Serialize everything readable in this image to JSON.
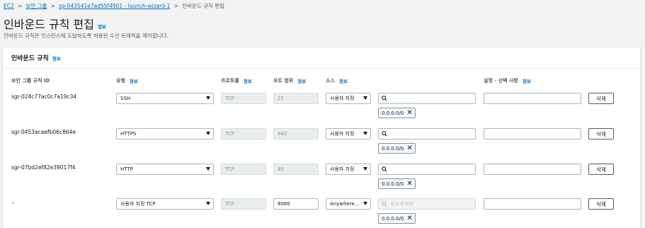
{
  "breadcrumbs": {
    "ec2": "EC2",
    "groups": "보안 그룹",
    "sg": "sg-043541e7ad55f4901 - launch-wizard-1",
    "current": "인바운드 규칙 편집",
    "separator": ">"
  },
  "page": {
    "title": "인바운드 규칙 편집",
    "info": "정보",
    "description": "인바운드 규칙은 인스턴스에 도달하도록 허용된 수신 트래픽을 제어합니다."
  },
  "panel": {
    "title": "인바운드 규칙",
    "info": "정보"
  },
  "columns": {
    "rule_id": "보안 그룹 규칙 ID",
    "type": "유형",
    "protocol": "프로토콜",
    "port_range": "포트 범위",
    "source": "소스",
    "description": "설명 - 선택 사항",
    "info": "정보"
  },
  "rules": [
    {
      "id": "sgr-024c77ac0c7a19c34",
      "type": "SSH",
      "protocol": "TCP",
      "port": "22",
      "source": "사용자 지정",
      "search_placeholder": "",
      "cidr": "0.0.0.0/0",
      "delete": "삭제"
    },
    {
      "id": "sgr-0453acaefb06c864e",
      "type": "HTTPS",
      "protocol": "TCP",
      "port": "443",
      "source": "사용자 지정",
      "search_placeholder": "",
      "cidr": "0.0.0.0/0",
      "delete": "삭제"
    },
    {
      "id": "sgr-07bd2ef82e39017f4",
      "type": "HTTP",
      "protocol": "TCP",
      "port": "80",
      "source": "사용자 지정",
      "search_placeholder": "",
      "cidr": "0.0.0.0/0",
      "delete": "삭제"
    },
    {
      "id": "–",
      "type": "사용자 지정 TCP",
      "protocol": "TCP",
      "port": "8080",
      "source": "Anywhere...",
      "search_placeholder": "0.0.0.0/0",
      "cidr": "0.0.0.0/0",
      "delete": "삭제"
    }
  ],
  "colors": {
    "link": "#0073bb",
    "background": "#f2f3f3",
    "token_bg": "#f2f8fd"
  },
  "icons": {
    "search": "search-icon",
    "remove": "close-icon",
    "dropdown": "caret-down-icon"
  }
}
